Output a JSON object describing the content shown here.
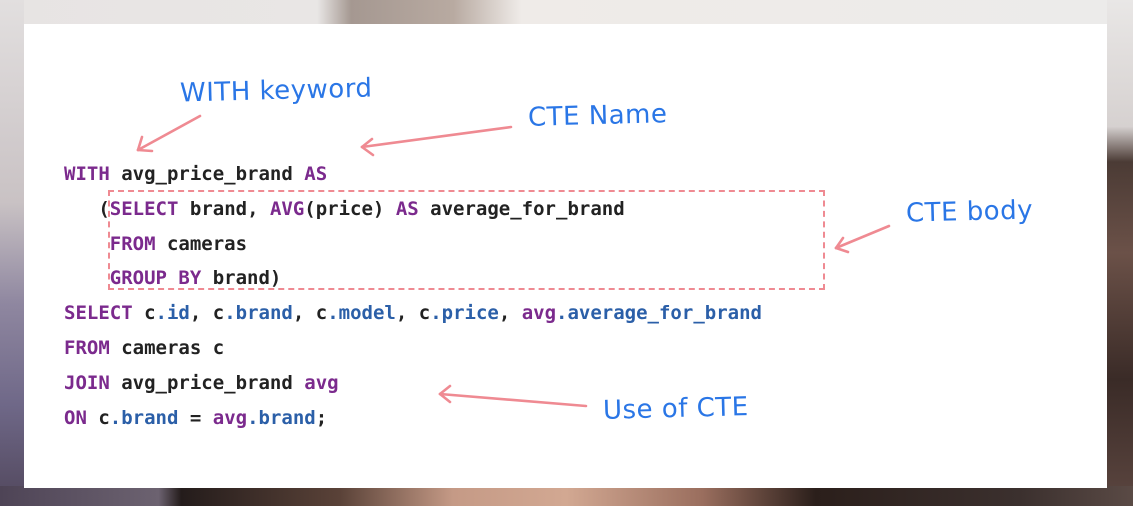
{
  "code": {
    "line1": {
      "kw1": "WITH",
      "name": "avg_price_brand",
      "kw2": "AS"
    },
    "line2": {
      "open": "(",
      "kw1": "SELECT",
      "t1": "brand,",
      "fn": "AVG",
      "t2": "(price)",
      "kw2": "AS",
      "t3": "average_for_brand"
    },
    "line3": {
      "kw": "FROM",
      "t": "cameras"
    },
    "line4": {
      "kw": "GROUP BY",
      "t": "brand)"
    },
    "line5": {
      "kw": "SELECT",
      "c1": "c",
      "p1": ".id",
      "sep1": ", ",
      "c2": "c",
      "p2": ".brand",
      "sep2": ", ",
      "c3": "c",
      "p3": ".model",
      "sep3": ", ",
      "c4": "c",
      "p4": ".price",
      "sep4": ", ",
      "a": "avg",
      "p5": ".average_for_brand"
    },
    "line6": {
      "kw": "FROM",
      "t": "cameras c"
    },
    "line7": {
      "kw": "JOIN",
      "t": "avg_price_brand",
      "alias": "avg"
    },
    "line8": {
      "kw": "ON",
      "c": "c",
      "p1": ".brand",
      "eq": " = ",
      "a": "avg",
      "p2": ".brand",
      "end": ";"
    }
  },
  "annotations": {
    "with_keyword": "WITH keyword",
    "cte_name": "CTE Name",
    "cte_body": "CTE body",
    "use_of_cte": "Use of CTE"
  },
  "colors": {
    "keyword": "#7b2a8d",
    "property": "#2b5fa8",
    "annotation": "#2a76e6",
    "arrow": "#ef8a92"
  }
}
